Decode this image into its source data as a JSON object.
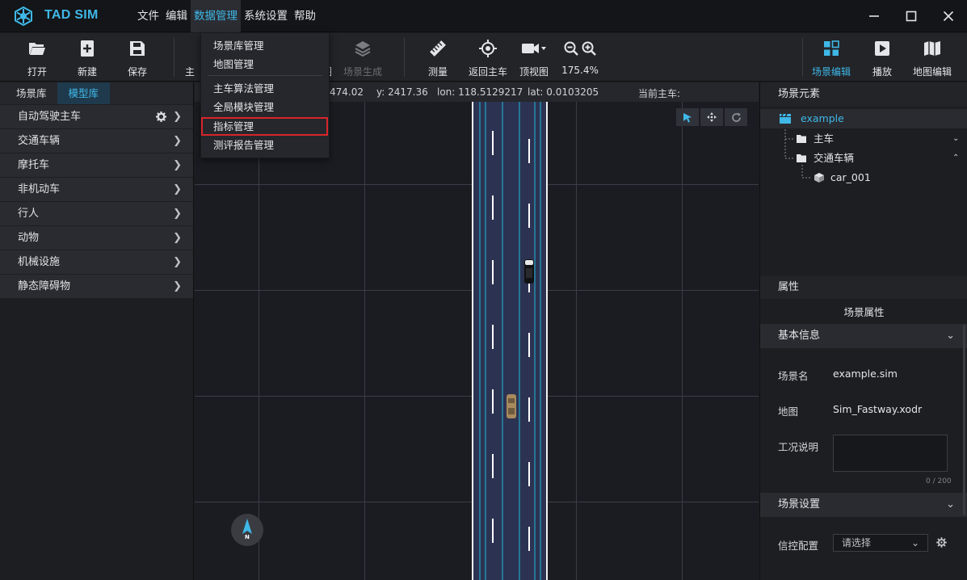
{
  "app": {
    "name": "TAD SIM",
    "accent": "#3fb8e8"
  },
  "menubar": {
    "items": [
      "文件",
      "编辑",
      "数据管理",
      "系统设置",
      "帮助"
    ],
    "active_index": 2
  },
  "data_menu": {
    "items": [
      "场景库管理",
      "地图管理",
      "主车算法管理",
      "全局模块管理",
      "指标管理",
      "测评报告管理"
    ],
    "highlighted": "指标管理"
  },
  "toolbar": {
    "open": "打开",
    "new": "新建",
    "save": "保存",
    "partial_main": "主",
    "partial_hidden": "图",
    "scene_gen": "场景生成",
    "measure": "测量",
    "back_to_ego": "返回主车",
    "top_view": "顶视图",
    "zoom": "175.4%",
    "scene_edit": "场景编辑",
    "play": "播放",
    "map_edit": "地图编辑"
  },
  "left_panel": {
    "tabs": [
      "场景库",
      "模型库"
    ],
    "active_tab": 1,
    "categories": [
      "自动驾驶主车",
      "交通车辆",
      "摩托车",
      "非机动车",
      "行人",
      "动物",
      "机械设施",
      "静态障碍物"
    ]
  },
  "viewport": {
    "x_partial": "474.02",
    "y": "y: 2417.36",
    "lon": "lon: 118.5129217",
    "lat": "lat: 0.0103205",
    "current_ego": "当前主车:",
    "compass_label": "N"
  },
  "right_panel": {
    "scene_elements_title": "场景元素",
    "tree": {
      "root": "example",
      "ego": "主车",
      "traffic": "交通车辆",
      "car": "car_001"
    },
    "properties_title": "属性",
    "scene_props_title": "场景属性",
    "basic_info": "基本信息",
    "scene_name_label": "场景名",
    "scene_name_value": "example.sim",
    "map_label": "地图",
    "map_value": "Sim_Fastway.xodr",
    "desc_label": "工况说明",
    "desc_count": "0 / 200",
    "scene_settings": "场景设置",
    "signal_label": "信控配置",
    "signal_placeholder": "请选择"
  }
}
